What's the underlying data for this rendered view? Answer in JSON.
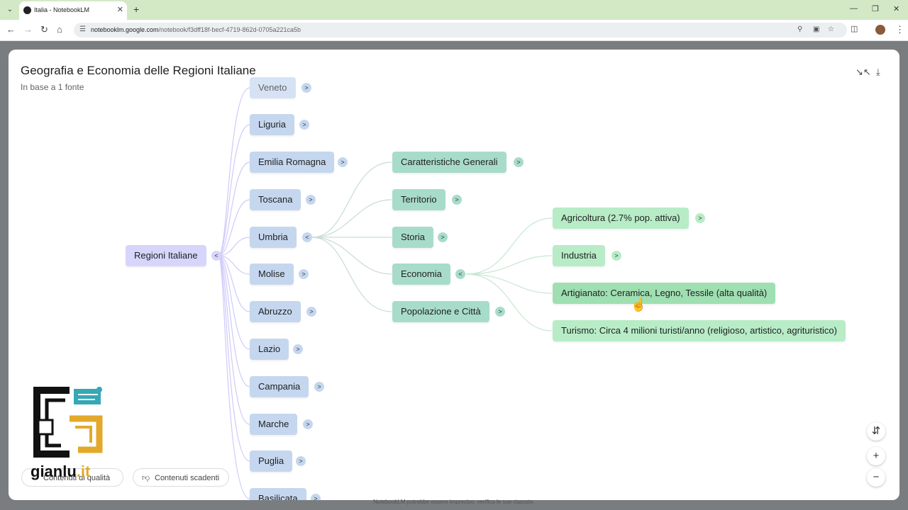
{
  "browser": {
    "tab_title": "Italia - NotebookLM",
    "url_host": "notebooklm.google.com",
    "url_path": "/notebook/f3dff18f-becf-4719-862d-0705a221ca5b"
  },
  "mindmap": {
    "title": "Geografia e Economia delle Regioni Italiane",
    "subtitle": "In base a 1 fonte",
    "root": {
      "label": "Regioni Italiane",
      "toggle": "<"
    },
    "regions": [
      {
        "label": "Veneto",
        "toggle": ">"
      },
      {
        "label": "Liguria",
        "toggle": ">"
      },
      {
        "label": "Emilia Romagna",
        "toggle": ">"
      },
      {
        "label": "Toscana",
        "toggle": ">"
      },
      {
        "label": "Umbria",
        "toggle": "<"
      },
      {
        "label": "Molise",
        "toggle": ">"
      },
      {
        "label": "Abruzzo",
        "toggle": ">"
      },
      {
        "label": "Lazio",
        "toggle": ">"
      },
      {
        "label": "Campania",
        "toggle": ">"
      },
      {
        "label": "Marche",
        "toggle": ">"
      },
      {
        "label": "Puglia",
        "toggle": ">"
      },
      {
        "label": "Basilicata",
        "toggle": ">"
      }
    ],
    "umbria_topics": [
      {
        "label": "Caratteristiche Generali",
        "toggle": ">"
      },
      {
        "label": "Territorio",
        "toggle": ">"
      },
      {
        "label": "Storia",
        "toggle": ">"
      },
      {
        "label": "Economia",
        "toggle": "<"
      },
      {
        "label": "Popolazione e Città",
        "toggle": ">"
      }
    ],
    "economia_items": [
      {
        "label": "Agricoltura (2.7% pop. attiva)",
        "toggle": ">"
      },
      {
        "label": "Industria",
        "toggle": ">"
      },
      {
        "label": "Artigianato: Ceramica, Legno, Tessile (alta qualità)",
        "toggle": ""
      },
      {
        "label": "Turismo: Circa 4 milioni turisti/anno (religioso, artistico, agrituristico)",
        "toggle": ""
      }
    ]
  },
  "feedback": {
    "good": "Contenuti di qualità",
    "bad": "Contenuti scadenti"
  },
  "disclaimer": "NotebookLM potrebbe essere impreciso; verifica le sue risposte.",
  "logo": {
    "name": "gianlu",
    "suffix": ".it"
  }
}
